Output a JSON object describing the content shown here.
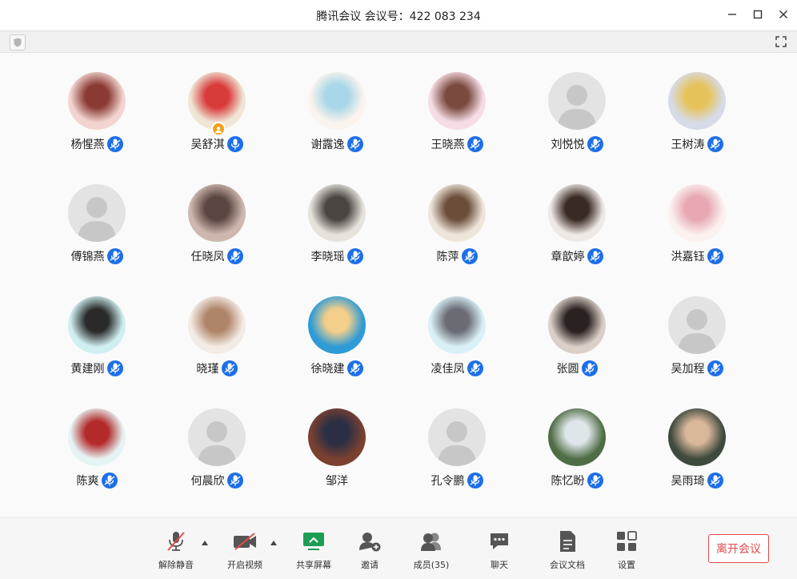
{
  "window": {
    "title": "腾讯会议 会议号：422 083 234"
  },
  "participants": [
    {
      "name": "杨惺燕",
      "photo": true,
      "colors": [
        "#f2d5d0",
        "#8a3a33"
      ]
    },
    {
      "name": "吴舒淇",
      "photo": true,
      "colors": [
        "#efe6d5",
        "#d93a3a"
      ],
      "host_badge": true,
      "mic_on": true
    },
    {
      "name": "谢露逸",
      "photo": true,
      "colors": [
        "#fbf3ee",
        "#a7d7e8"
      ]
    },
    {
      "name": "王晓燕",
      "photo": true,
      "colors": [
        "#f6dce5",
        "#7a4a3f"
      ]
    },
    {
      "name": "刘悦悦",
      "photo": false
    },
    {
      "name": "王树涛",
      "photo": true,
      "colors": [
        "#d6dbe7",
        "#e6c35a"
      ]
    },
    {
      "name": "傅锦燕",
      "photo": false
    },
    {
      "name": "任晓凤",
      "photo": true,
      "colors": [
        "#cdb7ae",
        "#5b4540"
      ]
    },
    {
      "name": "李晓瑶",
      "photo": true,
      "colors": [
        "#e7e2dc",
        "#4a4540"
      ]
    },
    {
      "name": "陈萍",
      "photo": true,
      "colors": [
        "#efe6db",
        "#6b4e3a"
      ]
    },
    {
      "name": "章歆婷",
      "photo": true,
      "colors": [
        "#efe9e6",
        "#3a2a24"
      ]
    },
    {
      "name": "洪嘉钰",
      "photo": true,
      "colors": [
        "#fbf1ef",
        "#e7a7b3"
      ]
    },
    {
      "name": "黄建刚",
      "photo": true,
      "colors": [
        "#cfeff0",
        "#2a2a2a"
      ]
    },
    {
      "name": "晓瑾",
      "photo": true,
      "colors": [
        "#f3ece6",
        "#b08468"
      ]
    },
    {
      "name": "徐晓建",
      "photo": true,
      "colors": [
        "#2d9bd6",
        "#f4cf8a"
      ]
    },
    {
      "name": "凌佳凤",
      "photo": true,
      "colors": [
        "#d9f1f6",
        "#6b6b74"
      ]
    },
    {
      "name": "张圆",
      "photo": true,
      "colors": [
        "#dbd0c9",
        "#2a2220"
      ]
    },
    {
      "name": "吴加程",
      "photo": false
    },
    {
      "name": "陈爽",
      "photo": true,
      "colors": [
        "#e6f3f4",
        "#b32a2a"
      ]
    },
    {
      "name": "何晨欣",
      "photo": false
    },
    {
      "name": "邹洋",
      "photo": true,
      "colors": [
        "#7a4030",
        "#2a2f45"
      ],
      "no_mic": true
    },
    {
      "name": "孔令鹏",
      "photo": false
    },
    {
      "name": "陈忆盼",
      "photo": true,
      "colors": [
        "#4f6d45",
        "#dfe6ea"
      ]
    },
    {
      "name": "吴雨琦",
      "photo": true,
      "colors": [
        "#3f4a3e",
        "#d9b79a"
      ]
    }
  ],
  "toolbar": {
    "unmute": "解除静音",
    "start_video": "开启视频",
    "share_screen": "共享屏幕",
    "invite": "邀请",
    "members": "成员(35)",
    "chat": "聊天",
    "docs": "会议文档",
    "settings": "设置",
    "leave": "离开会议"
  },
  "colors": {
    "accent": "#1d6fe8",
    "share": "#1e9e55",
    "leave": "#e24b4b"
  }
}
